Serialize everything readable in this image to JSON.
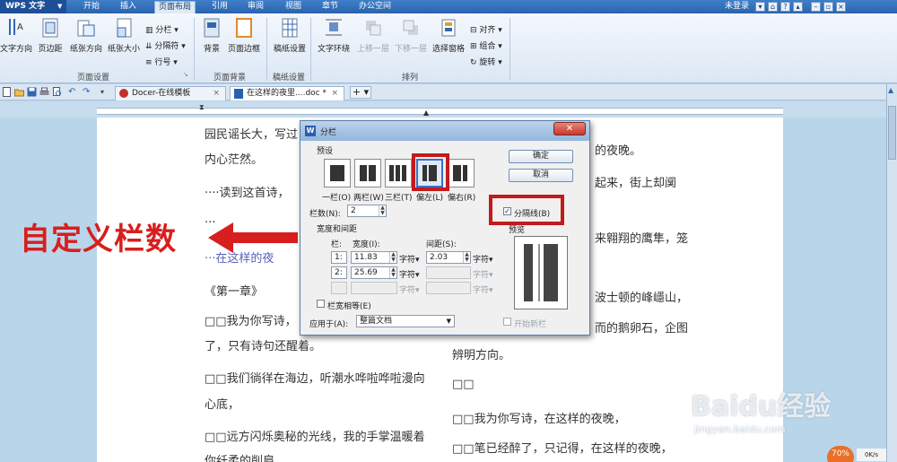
{
  "app": {
    "logo": "WPS 文字",
    "login": "未登录"
  },
  "menu": [
    "开始",
    "插入",
    "页面布局",
    "引用",
    "审阅",
    "视图",
    "章节",
    "办公空间"
  ],
  "ribbon": {
    "big_buttons": [
      "文字方向",
      "页边距",
      "纸张方向",
      "纸张大小",
      "背景",
      "页面边框",
      "稿纸设置",
      "文字环绕",
      "上移一层",
      "下移一层",
      "选择窗格"
    ],
    "small_buttons": [
      "分栏",
      "分隔符",
      "行号",
      "对齐",
      "组合",
      "旋转"
    ],
    "groups": [
      "页面设置",
      "页面背景",
      "稿纸设置",
      "排列"
    ]
  },
  "tabs": [
    {
      "label": "Docer-在线模板"
    },
    {
      "label": "在这样的夜里....doc *"
    }
  ],
  "document": {
    "left_lines": [
      "园民谣长大，写过",
      "内心茫然。",
      "····读到这首诗，",
      "···",
      "···在这样的夜",
      "《第一章》",
      "□□我为你写诗，",
      "了，只有诗句还醒着。",
      "□□我们徜徉在海边，听潮水哗啦哗啦漫向",
      "心底，",
      "□□远方闪烁奥秘的光线，我的手掌温暖着",
      "你纤柔的削肩"
    ],
    "right_lines": [
      "的夜晚。",
      "起来，街上却阒",
      "来翱翔的鹰隼，笼",
      "波士顿的峰嶾山，",
      "而的鹅卵石，企图",
      "辨明方向。",
      "□□",
      "□□我为你写诗，在这样的夜晚，",
      "□□笔已经醉了，只记得，在这样的夜晚，"
    ]
  },
  "annotation": {
    "text": "自定义栏数"
  },
  "dialog": {
    "title": "分栏",
    "preset_label": "预设",
    "presets": [
      "一栏(O)",
      "两栏(W)",
      "三栏(T)",
      "偏左(L)",
      "偏右(R)"
    ],
    "col_count_label": "栏数(N):",
    "col_count": "2",
    "width_spacing_label": "宽度和间距",
    "col_header": "栏:",
    "width_header": "宽度(I):",
    "spacing_header": "间距(S):",
    "rows": [
      {
        "col": "1:",
        "width": "11.83",
        "unit": "字符▾",
        "spacing": "2.03",
        "spacing_unit": "字符▾"
      },
      {
        "col": "2:",
        "width": "25.69",
        "unit": "字符▾",
        "spacing": "",
        "spacing_unit": "字符▾"
      },
      {
        "col": "",
        "width": "",
        "unit": "字符▾",
        "spacing": "",
        "spacing_unit": "字符▾"
      }
    ],
    "equal_width": "栏宽相等(E)",
    "apply_label": "应用于(A):",
    "apply_value": "整篇文档",
    "ok": "确定",
    "cancel": "取消",
    "separator": "分隔线(B)",
    "preview": "预览",
    "new_column": "开始新栏"
  },
  "status": {
    "zoom": "70%",
    "speed": "0K/s"
  },
  "watermark": {
    "text": "Baidu经验",
    "url": "jingyan.baidu.com"
  }
}
